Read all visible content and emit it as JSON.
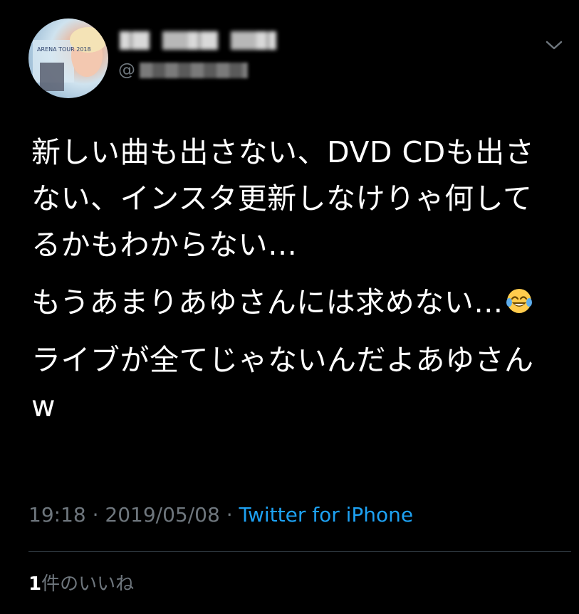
{
  "author": {
    "handle_prefix": "@",
    "avatar_text": "ARENA TOUR 2018",
    "icons": {
      "avatar": "profile-photo",
      "menu": "chevron-down-icon"
    }
  },
  "tweet": {
    "paragraphs": [
      "新しい曲も出さない、DVD CDも出さない、インスタ更新しなけりゃ何してるかもわからない…",
      "もうあまりあゆさんには求めない…",
      "ライブが全てじゃないんだよあゆさんw"
    ],
    "emoji": "face-with-tears-of-joy"
  },
  "meta": {
    "time": "19:18",
    "separator_1": " · ",
    "date": "2019/05/08",
    "separator_2": " · ",
    "source": "Twitter for iPhone"
  },
  "likes": {
    "count": "1",
    "label": "件のいいね"
  },
  "colors": {
    "background": "#000000",
    "text": "#ffffff",
    "muted": "#6e767d",
    "accent": "#1da1f2",
    "divider": "#38444d"
  }
}
